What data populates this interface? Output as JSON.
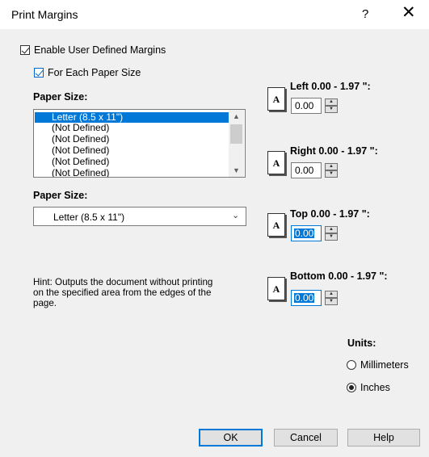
{
  "window": {
    "title": "Print Margins",
    "help_glyph": "?",
    "close_glyph": "✕"
  },
  "enable_user_margins": {
    "label": "Enable User Defined Margins",
    "checked": true
  },
  "for_each_paper_size": {
    "label": "For Each Paper Size",
    "checked": true
  },
  "paper_size_list": {
    "label": "Paper Size:",
    "items": [
      "Letter (8.5 x 11\")",
      "(Not Defined)",
      "(Not Defined)",
      "(Not Defined)",
      "(Not Defined)",
      "(Not Defined)"
    ],
    "selected_index": 0
  },
  "paper_size_combo": {
    "label": "Paper Size:",
    "value": "Letter (8.5 x 11\")"
  },
  "hint": "Hint: Outputs the document without printing on the specified area from the edges of the page.",
  "margins": {
    "icon_glyph": "A",
    "left": {
      "label": "Left 0.00 - 1.97 \":",
      "value": "0.00"
    },
    "right": {
      "label": "Right 0.00 - 1.97 \":",
      "value": "0.00"
    },
    "top": {
      "label": "Top 0.00 - 1.97 \":",
      "value": "0.00"
    },
    "bottom": {
      "label": "Bottom 0.00 - 1.97 \":",
      "value": "0.00"
    }
  },
  "units": {
    "label": "Units:",
    "options": [
      {
        "label": "Millimeters",
        "selected": false
      },
      {
        "label": "Inches",
        "selected": true
      }
    ]
  },
  "buttons": {
    "ok": "OK",
    "cancel": "Cancel",
    "help": "Help"
  }
}
